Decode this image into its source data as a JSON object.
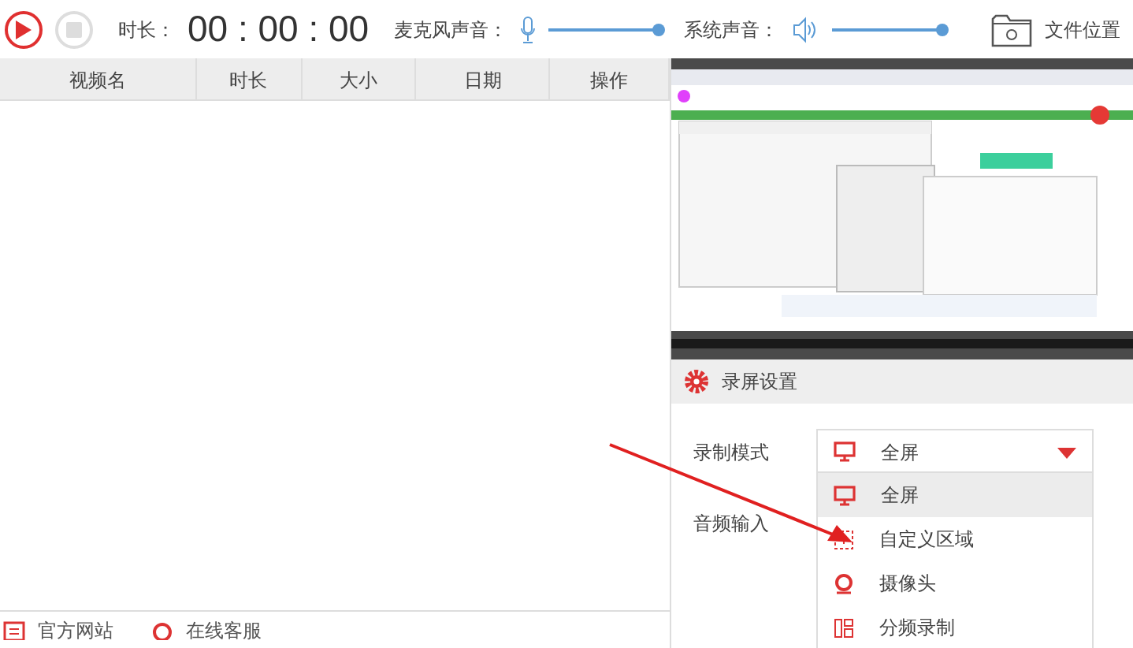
{
  "toolbar": {
    "play_button": {
      "kind": "play"
    },
    "stop_button": {
      "disabled": true
    },
    "duration_label": "时长：",
    "duration": "00 : 00 : 00",
    "mic": {
      "label": "麦克风声音：",
      "level": 1.0
    },
    "system": {
      "label": "系统声音：",
      "level": 1.0
    },
    "file_location": "文件位置"
  },
  "table": {
    "columns": [
      "视频名",
      "时长",
      "大小",
      "日期",
      "操作"
    ]
  },
  "settings": {
    "title": "录屏设置",
    "fields": [
      {
        "label": "录制模式",
        "value": "全屏"
      },
      {
        "label": "音频输入"
      }
    ],
    "dropdown": [
      {
        "label": "全屏",
        "kind": "monitor",
        "selected": true
      },
      {
        "label": "自定义区域",
        "kind": "region",
        "selected": false
      },
      {
        "label": "摄像头",
        "kind": "camera",
        "selected": false
      },
      {
        "label": "分频录制",
        "kind": "split",
        "selected": false
      }
    ]
  },
  "footer": [
    {
      "label": "官方网站",
      "kind": "site"
    },
    {
      "label": "在线客服",
      "kind": "service"
    }
  ]
}
